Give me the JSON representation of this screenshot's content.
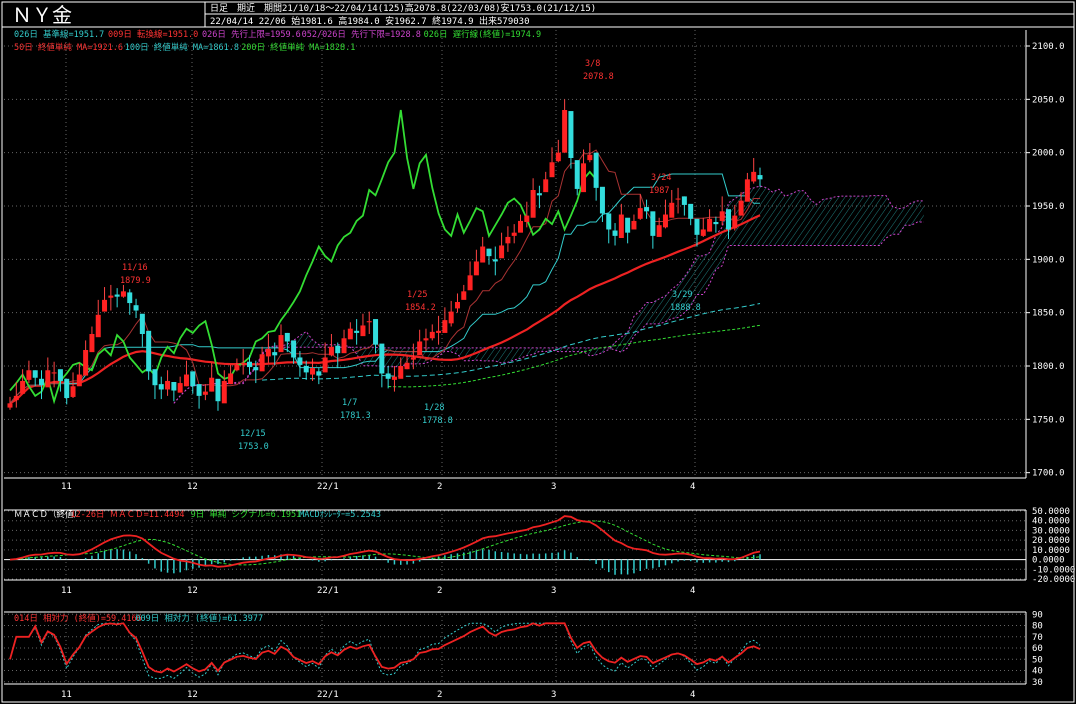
{
  "header": {
    "title": "ＮＹ金",
    "mode": "日足　期近",
    "period_line": "期間21/10/18～22/04/14(125)高2078.8(22/03/08)安1753.0(21/12/15)",
    "ohlc_line": "22/04/14 22/06 始1981.6 高1984.0 安1962.7 終1974.9 出来579030"
  },
  "legend": {
    "row1": [
      {
        "text": "026日 基準線=1951.7",
        "color": "#33cccc"
      },
      {
        "text": "009日 転換線=1951.0",
        "color": "#ff3333"
      },
      {
        "text": "026日 先行上限=1959.6",
        "color": "#cc44cc"
      },
      {
        "text": "052/026日 先行下限=1928.8",
        "color": "#cc44cc"
      },
      {
        "text": "026日 遅行線(終値)=1974.9",
        "color": "#33dd33"
      }
    ],
    "row2": [
      {
        "text": "50日 終値単純 MA=1921.6",
        "color": "#ff3333"
      },
      {
        "text": "100日 終値単純 MA=1861.8",
        "color": "#33cccc"
      },
      {
        "text": "200日 終値単純 MA=1828.1",
        "color": "#33dd33"
      }
    ]
  },
  "macd_legend": [
    {
      "text": "ＭＡＣＤ（終値）",
      "color": "#ffffff"
    },
    {
      "text": "12-26日 ＭＡＣＤ=11.4494",
      "color": "#ff3333"
    },
    {
      "text": "9日 単純 シグナル=6.1951",
      "color": "#33dd33"
    },
    {
      "text": "MACDｵｼﾚｰﾀｰ=5.2543",
      "color": "#33cccc"
    }
  ],
  "rsi_legend": [
    {
      "text": "014日 相対力 (終値)=59.4166",
      "color": "#ff3333"
    },
    {
      "text": "009日 相対力 (終値)=61.3977",
      "color": "#33cccc"
    }
  ],
  "chart_data": [
    {
      "type": "candlestick",
      "title": "ＮＹ金",
      "x_tick_labels": [
        "11",
        "12",
        "22/1",
        "2",
        "3",
        "4"
      ],
      "y_ticks": [
        1700,
        1750,
        1800,
        1850,
        1900,
        1950,
        2000,
        2050,
        2100
      ],
      "ylim": [
        1700,
        2115
      ],
      "grid": true,
      "annotations": [
        {
          "date": "11/16",
          "value": "1879.9",
          "color": "#ff3333"
        },
        {
          "date": "12/15",
          "value": "1753.0",
          "color": "#33cccc"
        },
        {
          "date": "1/7",
          "value": "1781.3",
          "color": "#33cccc"
        },
        {
          "date": "1/25",
          "value": "1854.2",
          "color": "#ff3333"
        },
        {
          "date": "1/28",
          "value": "1778.8",
          "color": "#33cccc"
        },
        {
          "date": "3/8",
          "value": "2078.8",
          "color": "#ff3333"
        },
        {
          "date": "3/24",
          "value": "1987",
          "color": "#ff3333"
        },
        {
          "date": "3/29",
          "value": "1888.8",
          "color": "#33cccc"
        }
      ],
      "closes_approx": [
        1765,
        1772,
        1786,
        1796,
        1789,
        1782,
        1796,
        1794,
        1786,
        1770,
        1781,
        1792,
        1815,
        1830,
        1848,
        1862,
        1866,
        1865,
        1870,
        1859,
        1852,
        1830,
        1795,
        1782,
        1778,
        1786,
        1777,
        1784,
        1792,
        1781,
        1772,
        1776,
        1789,
        1767,
        1786,
        1793,
        1801,
        1803,
        1799,
        1796,
        1811,
        1816,
        1810,
        1829,
        1823,
        1808,
        1801,
        1794,
        1798,
        1791,
        1808,
        1818,
        1812,
        1826,
        1835,
        1831,
        1838,
        1842,
        1820,
        1793,
        1788,
        1790,
        1800,
        1803,
        1808,
        1823,
        1826,
        1832,
        1833,
        1843,
        1851,
        1860,
        1870,
        1885,
        1898,
        1912,
        1903,
        1898,
        1913,
        1921,
        1925,
        1936,
        1941,
        1965,
        1960,
        1975,
        1991,
        2000,
        2040,
        1995,
        1966,
        1990,
        1998,
        1967,
        1943,
        1928,
        1922,
        1942,
        1925,
        1936,
        1948,
        1945,
        1922,
        1932,
        1942,
        1953,
        1957,
        1951,
        1938,
        1923,
        1928,
        1938,
        1933,
        1945,
        1928,
        1941,
        1955,
        1975,
        1982,
        1975
      ]
    },
    {
      "type": "line",
      "title": "ＭＡＣＤ（終値）",
      "y_ticks": [
        "50.0000",
        "40.0000",
        "30.0000",
        "20.0000",
        "10.0000",
        "0.0000",
        "-10.0000",
        "-20.0000"
      ],
      "ylim": [
        -20,
        50
      ],
      "series": [
        {
          "name": "12-26日 ＭＡＣＤ",
          "last": 11.4494
        },
        {
          "name": "9日 単純 シグナル",
          "last": 6.1951
        },
        {
          "name": "MACDｵｼﾚｰﾀｰ",
          "last": 5.2543
        }
      ]
    },
    {
      "type": "line",
      "title": "相対力",
      "y_ticks": [
        90,
        80,
        70,
        60,
        50,
        40,
        30
      ],
      "ylim": [
        30,
        90
      ],
      "series": [
        {
          "name": "014日 相対力 (終値)",
          "last": 59.4166
        },
        {
          "name": "009日 相対力 (終値)",
          "last": 61.3977
        }
      ]
    }
  ],
  "colors": {
    "up": "#ff2222",
    "down": "#33dddd",
    "tenkan": "#ff3333",
    "kijun": "#33cccc",
    "chikou": "#33dd33",
    "cloud": "#cc44cc",
    "grid": "#666666"
  }
}
